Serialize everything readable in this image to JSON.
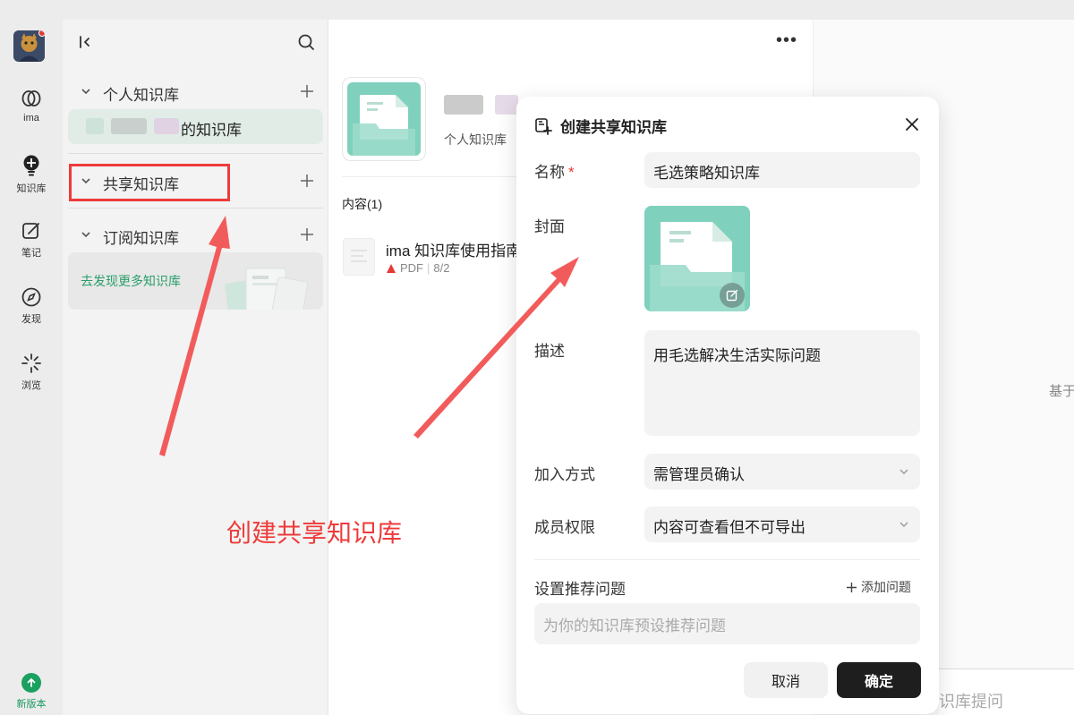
{
  "rail": {
    "items": [
      {
        "label": "ima",
        "icon": "ima-logo-icon"
      },
      {
        "label": "知识库",
        "icon": "knowledge-bulb-icon"
      },
      {
        "label": "笔记",
        "icon": "note-edit-icon"
      },
      {
        "label": "发现",
        "icon": "compass-icon"
      },
      {
        "label": "浏览",
        "icon": "browse-burst-icon"
      }
    ],
    "new_version": "新版本"
  },
  "sidebar": {
    "sections": [
      {
        "title": "个人知识库"
      },
      {
        "title": "共享知识库"
      },
      {
        "title": "订阅知识库"
      }
    ],
    "personal_item_suffix": "的知识库",
    "discover_label": "去发现更多知识库"
  },
  "main": {
    "kb_type": "个人知识库",
    "content_label": "内容(1)",
    "file": {
      "name": "ima 知识库使用指南",
      "type": "PDF",
      "date": "8/2"
    }
  },
  "right": {
    "hint": "基于",
    "input_placeholder": "识库提问"
  },
  "modal": {
    "title": "创建共享知识库",
    "name_label": "名称",
    "name_required": "*",
    "name_value": "毛选策略知识库",
    "cover_label": "封面",
    "desc_label": "描述",
    "desc_value": "用毛选解决生活实际问题",
    "join_label": "加入方式",
    "join_value": "需管理员确认",
    "perm_label": "成员权限",
    "perm_value": "内容可查看但不可导出",
    "rec_label": "设置推荐问题",
    "add_question": "添加问题",
    "rec_placeholder": "为你的知识库预设推荐问题",
    "cancel": "取消",
    "confirm": "确定"
  },
  "annotation": {
    "text": "创建共享知识库",
    "color": "#ee3b3b"
  },
  "colors": {
    "accent_green": "#1aa05f",
    "cover_teal": "#7fd1bd",
    "selected_bg": "#e1ece6"
  }
}
